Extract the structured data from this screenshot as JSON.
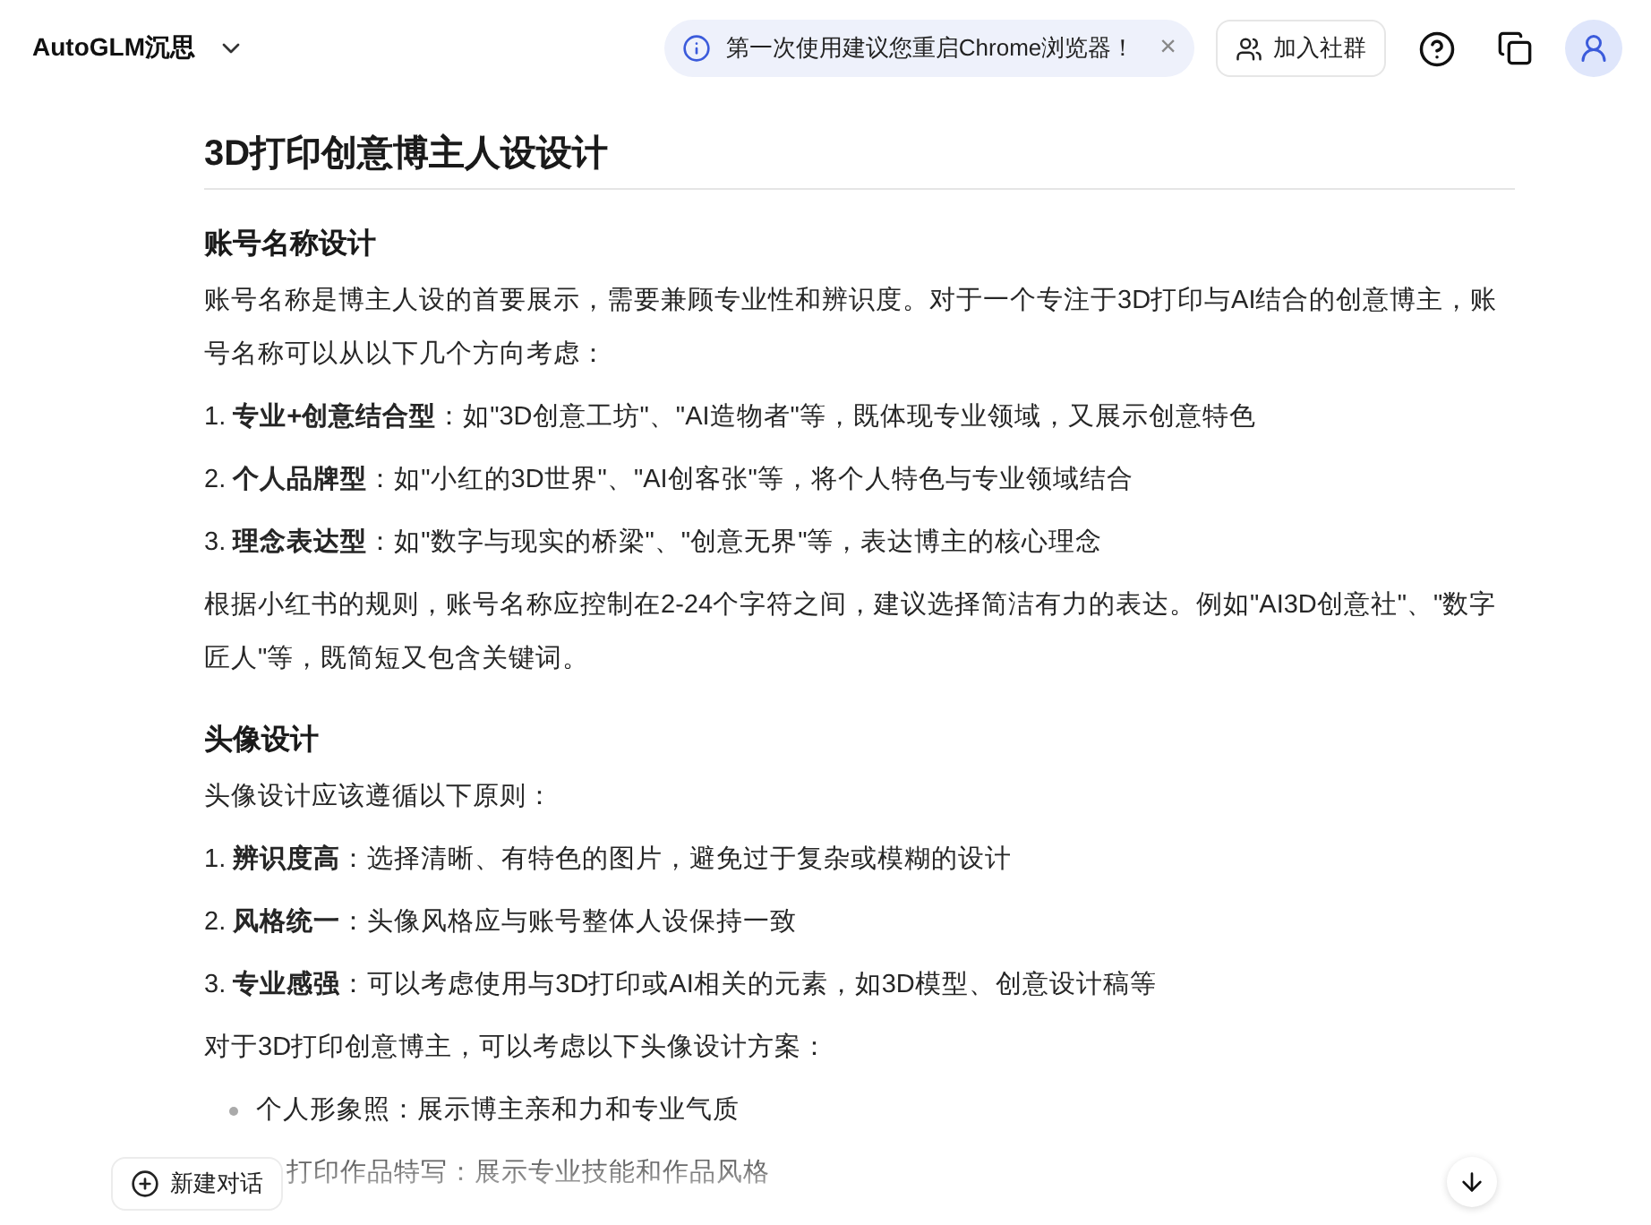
{
  "header": {
    "app_name": "AutoGLM沉思",
    "notice": "第一次使用建议您重启Chrome浏览器！",
    "close_glyph": "×",
    "join_button": "加入社群"
  },
  "article": {
    "title": "3D打印创意博主人设设计",
    "sections": [
      {
        "heading": "账号名称设计",
        "blocks": [
          {
            "kind": "para",
            "text": "账号名称是博主人设的首要展示，需要兼顾专业性和辨识度。对于一个专注于3D打印与AI结合的创意博主，账号名称可以从以下几个方向考虑："
          },
          {
            "kind": "item",
            "text": "1. **专业+创意结合型**：如\"3D创意工坊\"、\"AI造物者\"等，既体现专业领域，又展示创意特色"
          },
          {
            "kind": "item",
            "text": "2. **个人品牌型**：如\"小红的3D世界\"、\"AI创客张\"等，将个人特色与专业领域结合"
          },
          {
            "kind": "item",
            "text": "3. **理念表达型**：如\"数字与现实的桥梁\"、\"创意无界\"等，表达博主的核心理念"
          },
          {
            "kind": "para",
            "text": "根据小红书的规则，账号名称应控制在2-24个字符之间，建议选择简洁有力的表达。例如\"AI3D创意社\"、\"数字匠人\"等，既简短又包含关键词。"
          }
        ]
      },
      {
        "heading": "头像设计",
        "blocks": [
          {
            "kind": "para",
            "text": "头像设计应该遵循以下原则："
          },
          {
            "kind": "item",
            "text": "1. **辨识度高**：选择清晰、有特色的图片，避免过于复杂或模糊的设计"
          },
          {
            "kind": "item",
            "text": "2. **风格统一**：头像风格应与账号整体人设保持一致"
          },
          {
            "kind": "item",
            "text": "3. **专业感强**：可以考虑使用与3D打印或AI相关的元素，如3D模型、创意设计稿等"
          },
          {
            "kind": "para",
            "text": "对于3D打印创意博主，可以考虑以下头像设计方案："
          },
          {
            "kind": "bullet",
            "text": "个人形象照：展示博主亲和力和专业气质"
          },
          {
            "kind": "partial",
            "text": "打印作品特写：展示专业技能和作品风格"
          }
        ]
      }
    ]
  },
  "new_chat_button": "新建对话"
}
